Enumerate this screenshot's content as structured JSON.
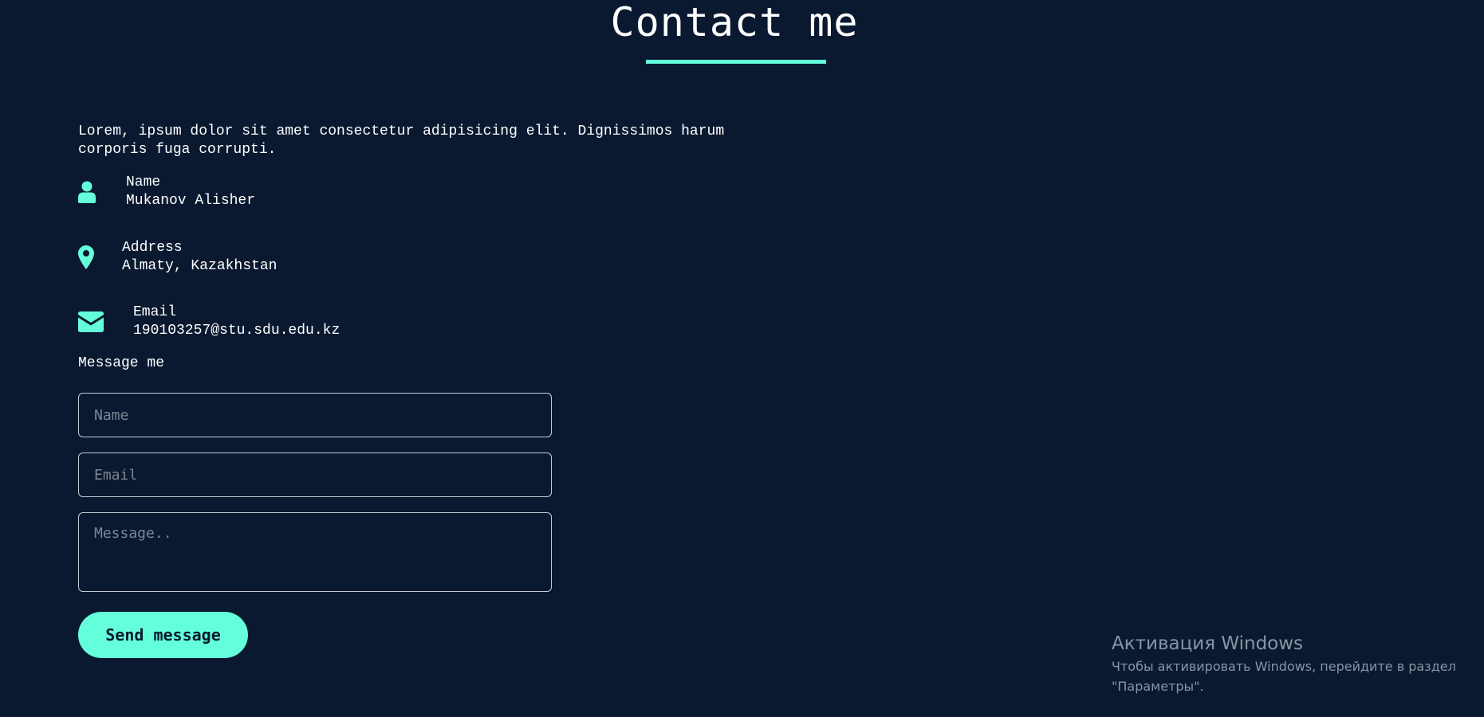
{
  "header": {
    "title": "Contact me"
  },
  "intro": {
    "text": "Lorem, ipsum dolor sit amet consectetur adipisicing elit. Dignissimos harum corporis fuga corrupti."
  },
  "contact_info": {
    "name": {
      "icon": "user-icon",
      "label": "Name",
      "value": "Mukanov Alisher"
    },
    "address": {
      "icon": "map-pin-icon",
      "label": "Address",
      "value": "Almaty, Kazakhstan"
    },
    "email": {
      "icon": "envelope-icon",
      "label": "Email",
      "value": "190103257@stu.sdu.edu.kz"
    }
  },
  "form": {
    "heading": "Message me",
    "name_placeholder": "Name",
    "name_value": "",
    "email_placeholder": "Email",
    "email_value": "",
    "message_placeholder": "Message..",
    "message_value": "",
    "submit_label": "Send message"
  },
  "windows_watermark": {
    "title": "Активация Windows",
    "line1": "Чтобы активировать Windows, перейдите в раздел",
    "line2": "\"Параметры\"."
  },
  "colors": {
    "background": "#0a1930",
    "accent": "#64ffda",
    "text": "#ffffff"
  }
}
